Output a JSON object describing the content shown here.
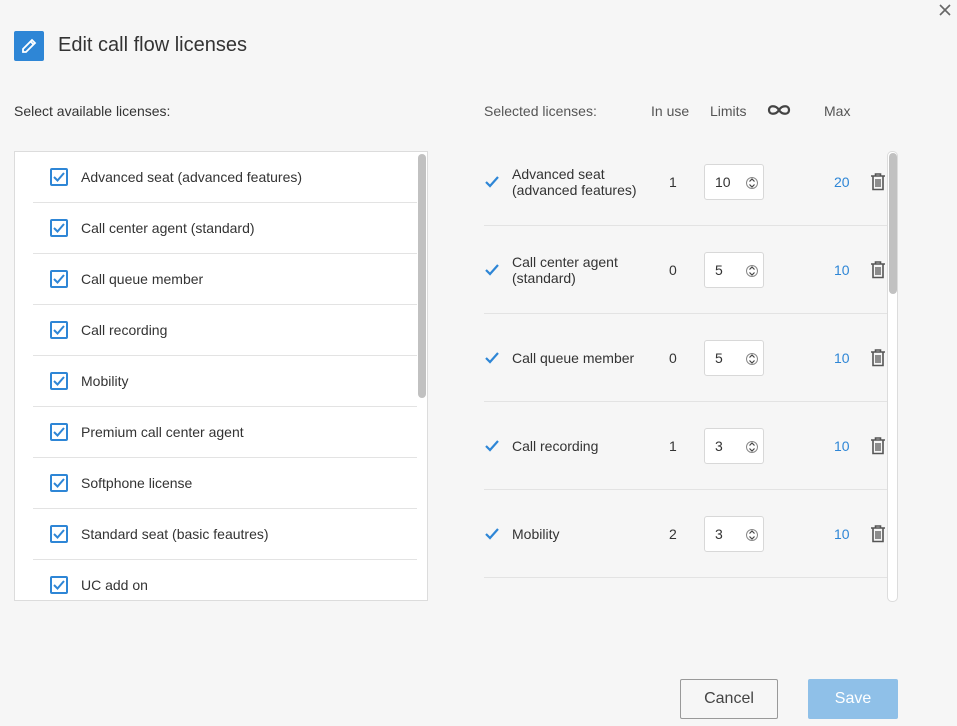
{
  "dialog": {
    "title": "Edit call flow licenses",
    "close_icon": "close-icon",
    "title_icon": "pencil-icon"
  },
  "available": {
    "label": "Select available licenses:",
    "items": [
      {
        "label": "Advanced seat (advanced features)",
        "checked": true
      },
      {
        "label": "Call center agent (standard)",
        "checked": true
      },
      {
        "label": "Call queue member",
        "checked": true
      },
      {
        "label": "Call recording",
        "checked": true
      },
      {
        "label": "Mobility",
        "checked": true
      },
      {
        "label": "Premium call center agent",
        "checked": true
      },
      {
        "label": "Softphone license",
        "checked": true
      },
      {
        "label": "Standard seat (basic feautres)",
        "checked": true
      },
      {
        "label": "UC add on",
        "checked": true
      }
    ]
  },
  "selected": {
    "headers": {
      "selected": "Selected licenses:",
      "in_use": "In use",
      "limits": "Limits",
      "unlimited_icon": "infinity-icon",
      "max": "Max"
    },
    "rows": [
      {
        "name": "Advanced seat (advanced features)",
        "in_use": "1",
        "limit": "10",
        "max": "20"
      },
      {
        "name": "Call center agent (standard)",
        "in_use": "0",
        "limit": "5",
        "max": "10"
      },
      {
        "name": "Call queue member",
        "in_use": "0",
        "limit": "5",
        "max": "10"
      },
      {
        "name": "Call recording",
        "in_use": "1",
        "limit": "3",
        "max": "10"
      },
      {
        "name": "Mobility",
        "in_use": "2",
        "limit": "3",
        "max": "10"
      }
    ]
  },
  "footer": {
    "cancel_label": "Cancel",
    "save_label": "Save"
  },
  "colors": {
    "accent": "#2e86d6",
    "save_disabled": "#8fc0e8",
    "background": "#f6f6f6"
  }
}
